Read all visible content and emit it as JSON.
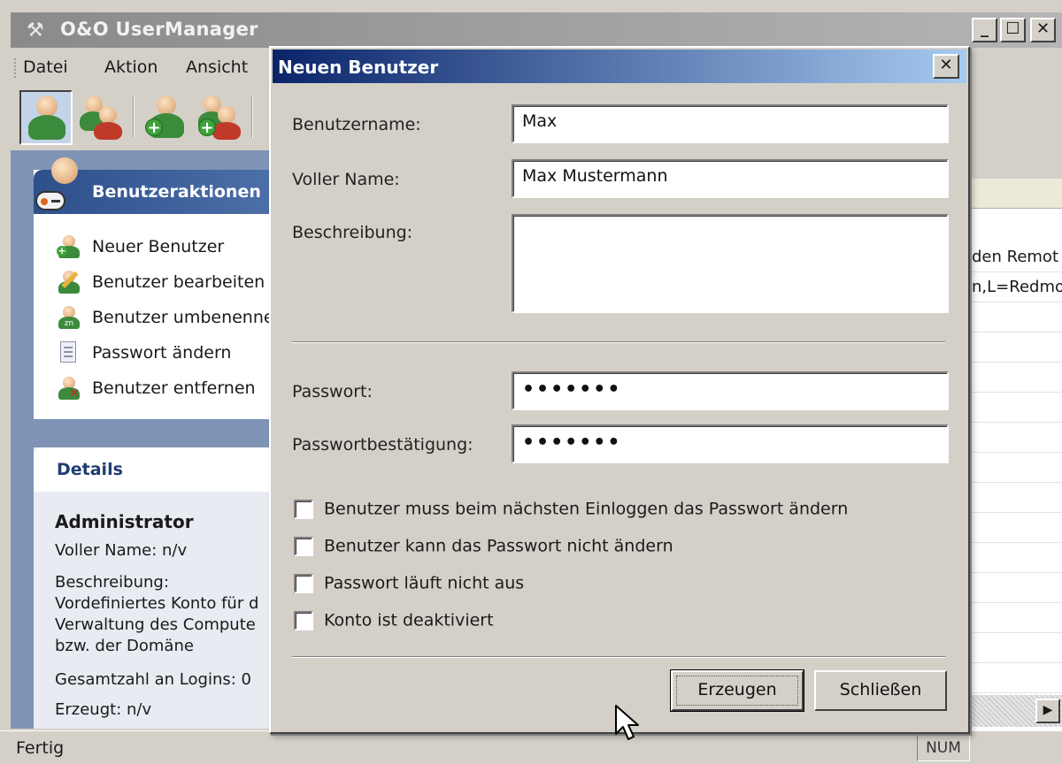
{
  "app": {
    "title": "O&O UserManager",
    "window_controls": [
      "_",
      "☐",
      "✕"
    ],
    "menu": [
      "Datei",
      "Aktion",
      "Ansicht"
    ]
  },
  "toolbar": {
    "buttons": [
      "user-icon",
      "users-icon",
      "add-user-icon",
      "add-users-icon"
    ]
  },
  "actions_panel": {
    "title": "Benutzeraktionen",
    "items": [
      {
        "label": "Neuer Benutzer",
        "icon": "add-user-icon"
      },
      {
        "label": "Benutzer bearbeiten",
        "icon": "edit-user-icon"
      },
      {
        "label": "Benutzer umbenennen",
        "icon": "rename-user-icon"
      },
      {
        "label": "Passwort ändern",
        "icon": "password-icon"
      },
      {
        "label": "Benutzer entfernen",
        "icon": "remove-user-icon"
      }
    ]
  },
  "details_panel": {
    "title": "Details",
    "user": "Administrator",
    "full_name": "Voller Name: n/v",
    "description_label": "Beschreibung:",
    "description_lines": [
      "Vordefiniertes Konto für d",
      "Verwaltung des Compute",
      "bzw. der Domäne"
    ],
    "logins": "Gesamtzahl an Logins: 0",
    "created": "Erzeugt: n/v"
  },
  "list_area": {
    "rows": [
      "den Remot",
      "n,L=Redmo"
    ]
  },
  "status": {
    "text": "Fertig",
    "num": "NUM"
  },
  "dialog": {
    "title": "Neuen Benutzer",
    "close": "✕",
    "fields": {
      "username_label": "Benutzername:",
      "username_value": "Max",
      "fullname_label": "Voller Name:",
      "fullname_value": "Max Mustermann",
      "description_label": "Beschreibung:",
      "description_value": "",
      "password_label": "Passwort:",
      "password_value": "•••••••",
      "confirm_label": "Passwortbestätigung:",
      "confirm_value": "•••••••"
    },
    "checkboxes": [
      {
        "label": "Benutzer muss beim nächsten Einloggen das Passwort ändern",
        "checked": false
      },
      {
        "label": "Benutzer kann das Passwort nicht ändern",
        "checked": false
      },
      {
        "label": "Passwort läuft nicht aus",
        "checked": false
      },
      {
        "label": "Konto ist deaktiviert",
        "checked": false
      }
    ],
    "buttons": {
      "create": "Erzeugen",
      "close": "Schließen"
    }
  }
}
